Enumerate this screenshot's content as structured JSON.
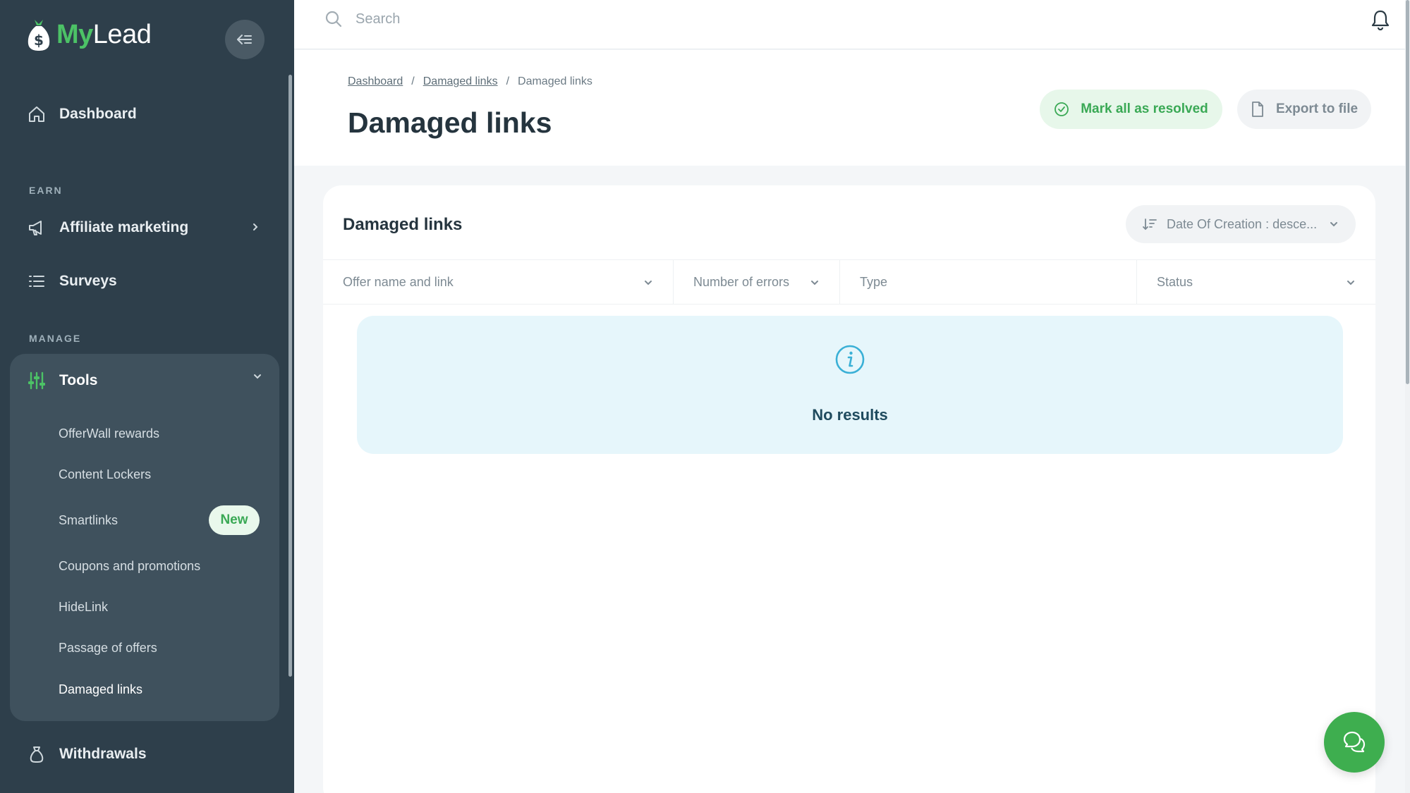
{
  "brand": {
    "my": "My",
    "lead": "Lead"
  },
  "colors": {
    "sidebar": "#2e3f4b",
    "accent": "#3eae4f",
    "info": "#e6f6fb"
  },
  "sidebar": {
    "dashboard": "Dashboard",
    "earn_label": "EARN",
    "affiliate": "Affiliate marketing",
    "surveys": "Surveys",
    "manage_label": "MANAGE",
    "tools": "Tools",
    "tools_items": [
      {
        "label": "OfferWall rewards"
      },
      {
        "label": "Content Lockers"
      },
      {
        "label": "Smartlinks",
        "badge": "New"
      },
      {
        "label": "Coupons and promotions"
      },
      {
        "label": "HideLink"
      },
      {
        "label": "Passage of offers"
      },
      {
        "label": "Damaged links",
        "active": true
      }
    ],
    "withdrawals": "Withdrawals"
  },
  "search": {
    "placeholder": "Search"
  },
  "breadcrumb": [
    "Dashboard",
    "Damaged links",
    "Damaged links"
  ],
  "header": {
    "title": "Damaged links",
    "resolve_label": "Mark all as resolved",
    "export_label": "Export to file"
  },
  "card": {
    "title": "Damaged links",
    "sort_label": "Date Of Creation : desce...",
    "columns": [
      "Offer name and link",
      "Number of errors",
      "Type",
      "Status"
    ],
    "empty_text": "No results"
  }
}
